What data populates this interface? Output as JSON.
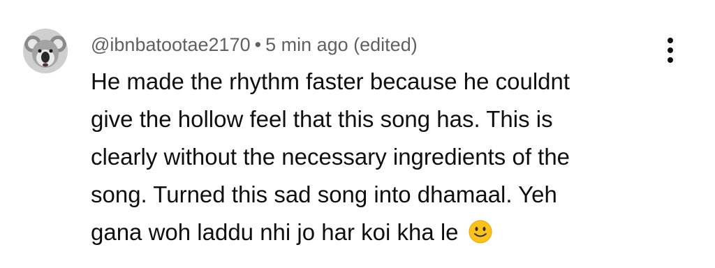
{
  "comment": {
    "author": "@ibnbatootae2170",
    "separator": "•",
    "time": "5 min ago",
    "edited": "(edited)",
    "avatar_icon": "koala-avatar",
    "emoji_icon": "slightly-smiling-face-icon",
    "menu_icon": "vertical-ellipsis-icon",
    "lines": [
      "He made the rhythm faster because he couldnt",
      "give the hollow feel that this song has. This is",
      "clearly without the necessary ingredients of the",
      "song. Turned this sad song into dhamaal. Yeh",
      "gana woh laddu nhi jo har koi kha le"
    ]
  }
}
